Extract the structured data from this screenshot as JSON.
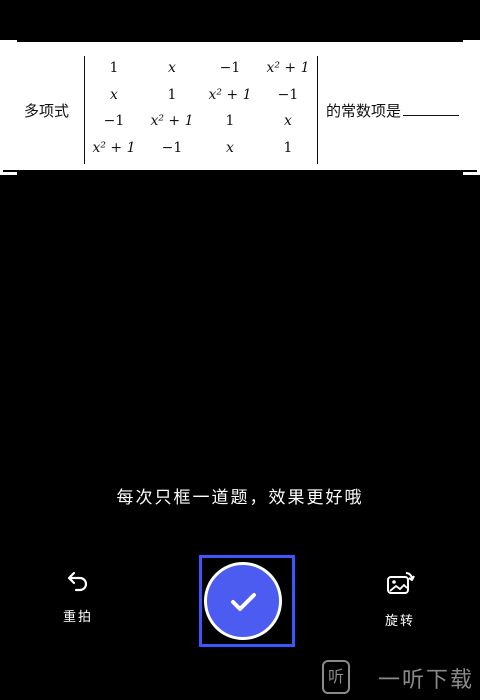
{
  "question": {
    "prefix": "多项式",
    "suffix": "的常数项是",
    "matrix": [
      [
        "1",
        "x",
        "−1",
        "x² + 1"
      ],
      [
        "x",
        "1",
        "x² + 1",
        "−1"
      ],
      [
        "−1",
        "x² + 1",
        "1",
        "x"
      ],
      [
        "x² + 1",
        "−1",
        "x",
        "1"
      ]
    ]
  },
  "hint": "每次只框一道题，效果更好哦",
  "controls": {
    "retake_label": "重拍",
    "rotate_label": "旋转"
  },
  "watermark": {
    "text": "一听下载",
    "logo_char": "听"
  },
  "colors": {
    "accent": "#4c5cf0",
    "frame": "#3a56ff"
  },
  "icons": [
    "undo-arrow-icon",
    "check-icon",
    "rotate-image-icon"
  ]
}
